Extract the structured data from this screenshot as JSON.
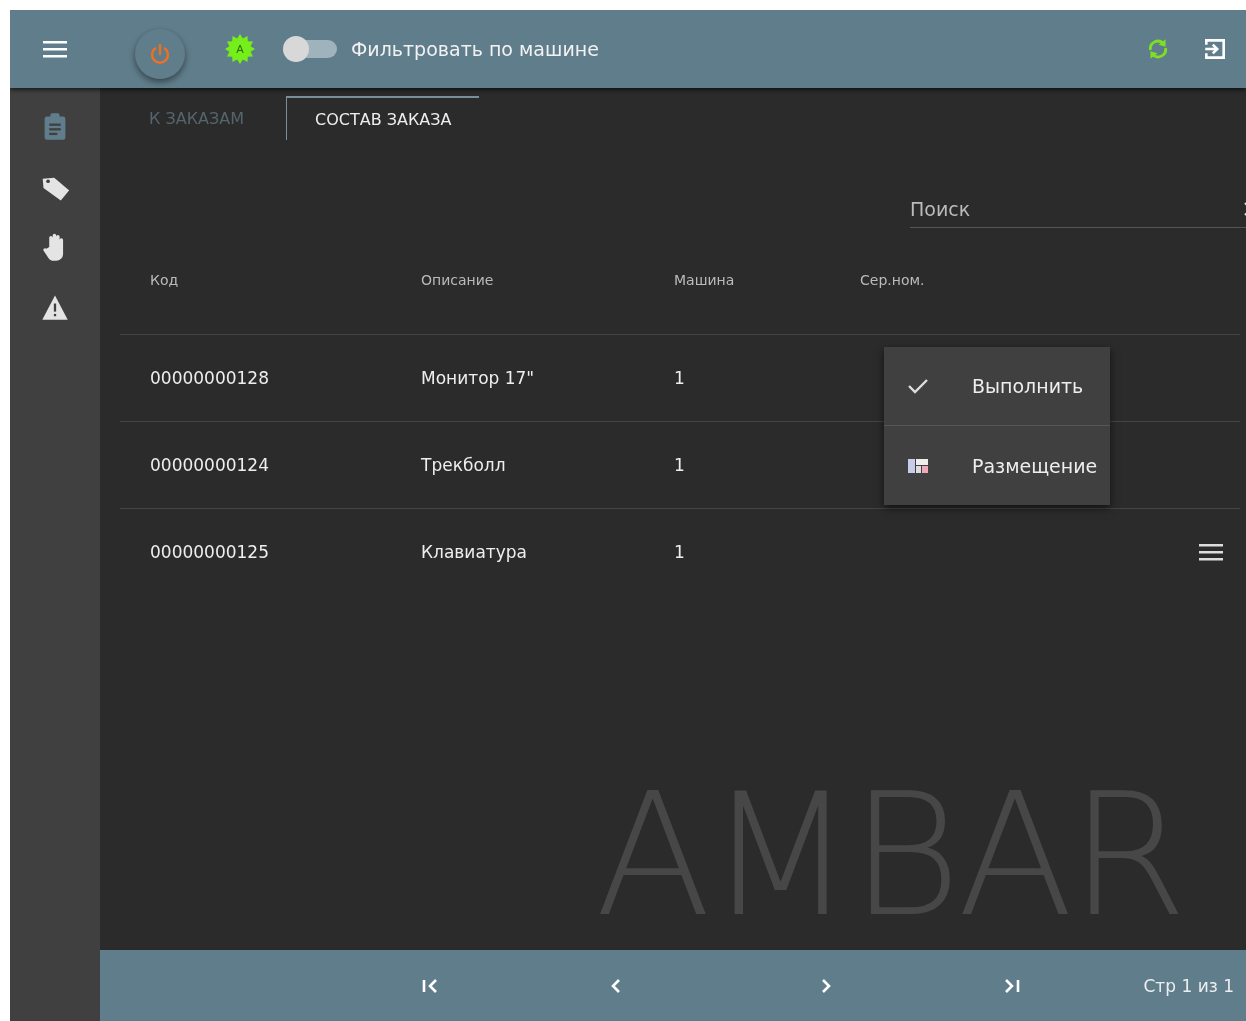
{
  "header": {
    "filter_toggle": {
      "label": "Фильтровать по машине",
      "on": false
    },
    "status_badge": "A"
  },
  "sidebar": {
    "items": [
      {
        "kind": "clipboard",
        "selected": true
      },
      {
        "kind": "tag",
        "selected": false
      },
      {
        "kind": "hand",
        "selected": false
      },
      {
        "kind": "warning",
        "selected": false
      }
    ]
  },
  "tabs": [
    {
      "label": "К ЗАКАЗАМ",
      "selected": false
    },
    {
      "label": "СОСТАВ ЗАКАЗА",
      "selected": true
    }
  ],
  "search": {
    "placeholder": "Поиск"
  },
  "table": {
    "columns": [
      "Код",
      "Описание",
      "Машина",
      "Сер.ном."
    ],
    "rows": [
      {
        "cells": [
          "00000000128",
          "Монитор 17\"",
          "1",
          ""
        ]
      },
      {
        "cells": [
          "00000000124",
          "Трекболл",
          "1",
          ""
        ]
      },
      {
        "cells": [
          "00000000125",
          "Клавиатура",
          "1",
          ""
        ]
      }
    ]
  },
  "context_menu": {
    "items": [
      {
        "kind": "check",
        "label": "Выполнить"
      },
      {
        "kind": "layout",
        "label": "Размещение"
      }
    ]
  },
  "background_logo": "AMBAR",
  "pager": {
    "status": "Стр 1 из 1"
  }
}
